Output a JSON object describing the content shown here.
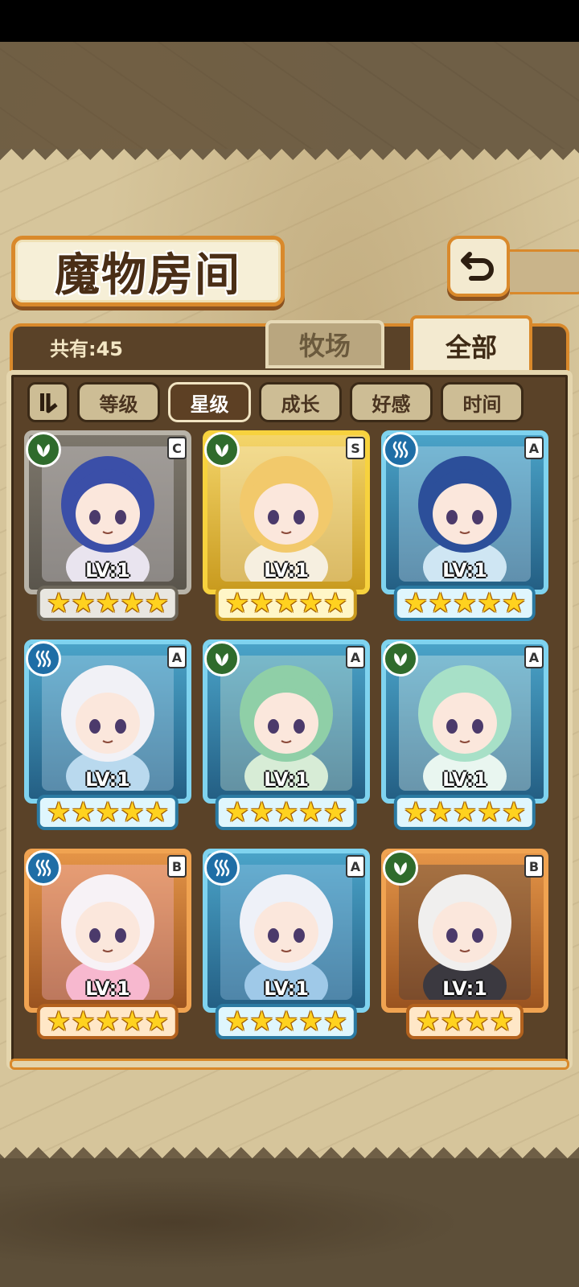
{
  "title": "魔物房间",
  "count_label": "共有:45",
  "tabs": {
    "ranch": "牧场",
    "all": "全部"
  },
  "sort": {
    "level": "等级",
    "star": "星级",
    "growth": "成长",
    "affection": "好感",
    "time": "时间",
    "active": "星级"
  },
  "monsters": [
    {
      "level": "LV:1",
      "rank": "C",
      "element": "leaf-icon",
      "stars": 5
    },
    {
      "level": "LV:1",
      "rank": "S",
      "element": "leaf-icon",
      "stars": 5
    },
    {
      "level": "LV:1",
      "rank": "A",
      "element": "water-icon",
      "stars": 5
    },
    {
      "level": "LV:1",
      "rank": "A",
      "element": "water-icon",
      "stars": 5
    },
    {
      "level": "LV:1",
      "rank": "A",
      "element": "leaf-icon",
      "stars": 5
    },
    {
      "level": "LV:1",
      "rank": "A",
      "element": "leaf-icon",
      "stars": 5
    },
    {
      "level": "LV:1",
      "rank": "B",
      "element": "water-icon",
      "stars": 5
    },
    {
      "level": "LV:1",
      "rank": "A",
      "element": "water-icon",
      "stars": 5
    },
    {
      "level": "LV:1",
      "rank": "B",
      "element": "leaf-icon",
      "stars": 4
    }
  ],
  "colors": {
    "accent": "#d9892b",
    "panel": "#5a4228",
    "paper": "#d6c59b"
  }
}
